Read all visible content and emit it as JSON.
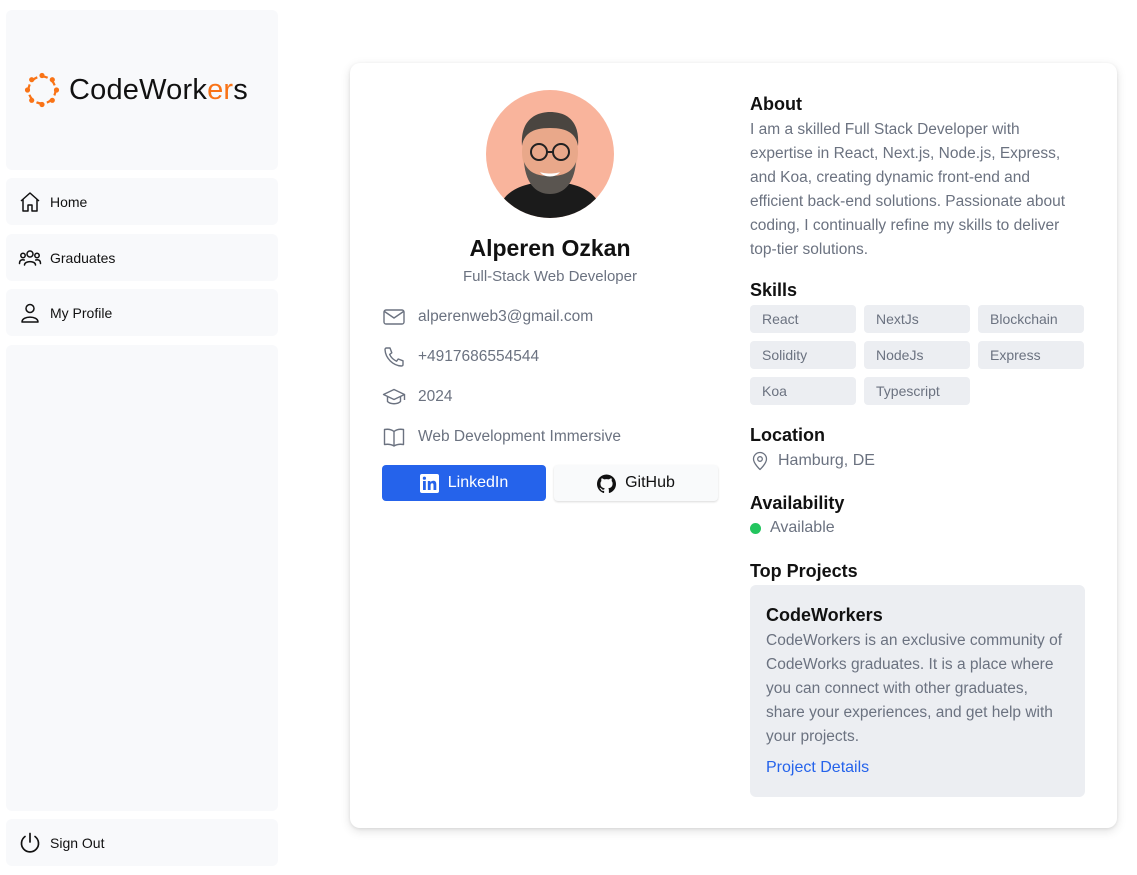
{
  "app": {
    "logo_prefix": "CodeWork",
    "logo_accent": "er",
    "logo_suffix": "s",
    "accent_color": "#f97316"
  },
  "sidebar": {
    "items": [
      {
        "label": "Home",
        "icon": "home-icon"
      },
      {
        "label": "Graduates",
        "icon": "users-icon"
      },
      {
        "label": "My Profile",
        "icon": "user-icon"
      }
    ],
    "sign_out": {
      "label": "Sign Out",
      "icon": "power-icon"
    }
  },
  "profile": {
    "name": "Alperen Ozkan",
    "role": "Full-Stack Web Developer",
    "email": "alperenweb3@gmail.com",
    "phone": "+4917686554544",
    "graduation_year": "2024",
    "program": "Web Development Immersive",
    "linkedin_label": "LinkedIn",
    "github_label": "GitHub",
    "linkedin_color": "#2563eb"
  },
  "about": {
    "heading": "About",
    "text": "I am a skilled Full Stack Developer with expertise in React, Next.js, Node.js, Express, and Koa, creating dynamic front-end and efficient back-end solutions. Passionate about coding, I continually refine my skills to deliver top-tier solutions."
  },
  "skills": {
    "heading": "Skills",
    "items": [
      "React",
      "NextJs",
      "Blockchain",
      "Solidity",
      "NodeJs",
      "Express",
      "Koa",
      "Typescript"
    ]
  },
  "location": {
    "heading": "Location",
    "value": "Hamburg, DE"
  },
  "availability": {
    "heading": "Availability",
    "value": "Available",
    "status_color": "#22c55e"
  },
  "projects": {
    "heading": "Top Projects",
    "items": [
      {
        "title": "CodeWorkers",
        "description": "CodeWorkers is an exclusive community of CodeWorks graduates. It is a place where you can connect with other graduates, share your experiences, and get help with your projects.",
        "link_label": "Project Details"
      }
    ]
  }
}
